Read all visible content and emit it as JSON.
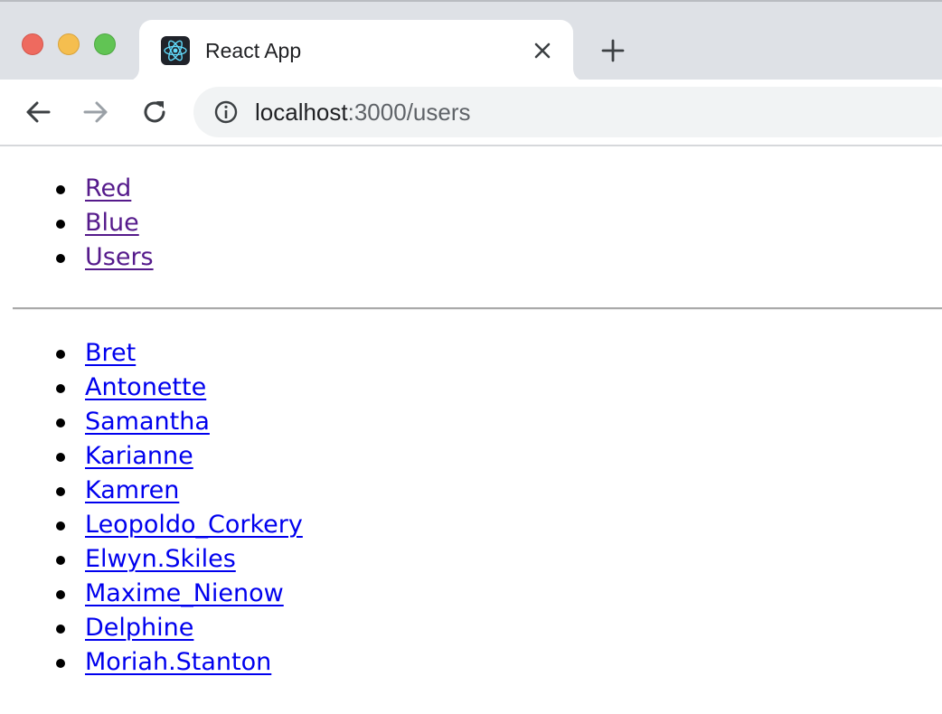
{
  "browser": {
    "tab": {
      "title": "React App",
      "favicon": "react-logo-icon"
    },
    "toolbar": {
      "icons": [
        "back-arrow-icon",
        "forward-arrow-icon",
        "reload-icon",
        "info-icon",
        "close-icon",
        "plus-icon"
      ],
      "url_host": "localhost",
      "url_rest": ":3000/users"
    },
    "colors": {
      "visited_link": "#551a8b",
      "link": "#0000ee",
      "tabstrip": "#dee1e6",
      "omnibox": "#f1f3f4"
    }
  },
  "page": {
    "nav_links": [
      {
        "label": "Red"
      },
      {
        "label": "Blue"
      },
      {
        "label": "Users"
      }
    ],
    "users": [
      {
        "label": "Bret"
      },
      {
        "label": "Antonette"
      },
      {
        "label": "Samantha"
      },
      {
        "label": "Karianne"
      },
      {
        "label": "Kamren"
      },
      {
        "label": "Leopoldo_Corkery"
      },
      {
        "label": "Elwyn.Skiles"
      },
      {
        "label": "Maxime_Nienow"
      },
      {
        "label": "Delphine"
      },
      {
        "label": "Moriah.Stanton"
      }
    ]
  }
}
